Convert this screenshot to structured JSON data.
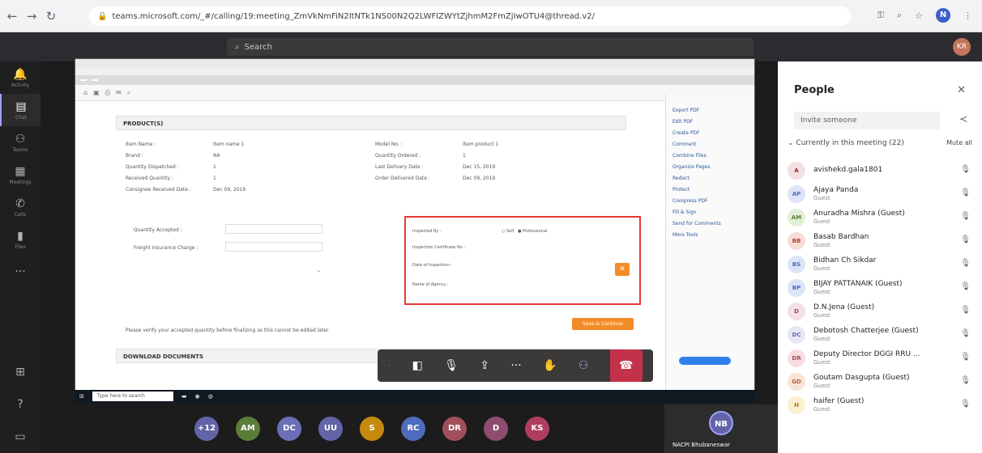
{
  "browser": {
    "url": "teams.microsoft.com/_#/calling/19:meeting_ZmVkNmFiN2ItNTk1NS00N2Q2LWFlZWYtZjhmM2FmZjIwOTU4@thread.v2/",
    "profile_initial": "N"
  },
  "teams": {
    "search_placeholder": "Search",
    "me_initials": "KR"
  },
  "rail": [
    {
      "icon": "bell-icon",
      "label": "Activity"
    },
    {
      "icon": "chat-icon",
      "label": "Chat"
    },
    {
      "icon": "teams-icon",
      "label": "Teams"
    },
    {
      "icon": "calendar-icon",
      "label": "Meetings"
    },
    {
      "icon": "phone-icon",
      "label": "Calls"
    },
    {
      "icon": "files-icon",
      "label": "Files"
    }
  ],
  "shared_screen": {
    "section_product": "PRODUCT(S)",
    "section_download": "DOWNLOAD DOCUMENTS",
    "verify_note": "Please verify your accepted quantity before finalizing as this cannot be edited later",
    "save_button": "Save & Continue",
    "left_fields": [
      "Item Name :",
      "Brand :",
      "Quantity Dispatched :",
      "Received Quantity :",
      "Consignee Received Date :"
    ],
    "left_values": [
      "Item name 1",
      "NA",
      "1",
      "1",
      "Dec 09, 2019"
    ],
    "right_fields": [
      "Model No. :",
      "Quantity Ordered :",
      "Last Delivery Date :",
      "Order Delivered Date :"
    ],
    "right_values": [
      "Item product 1",
      "1",
      "Dec 15, 2019",
      "Dec 09, 2019"
    ],
    "accept_fields": [
      "Quantity Accepted :",
      "Freight Insurance Charge :"
    ],
    "inspection_labels": [
      "Inspected By :",
      "Inspection Certificate No :",
      "Date of Inspection :",
      "Name of Agency :"
    ],
    "inspected_options": [
      "Self",
      "Professional"
    ],
    "taskbar_search": "Type here to search",
    "pdf_items": [
      "Export PDF",
      "Edit PDF",
      "Create PDF",
      "Comment",
      "Combine Files",
      "Organize Pages",
      "Redact",
      "Protect",
      "Compress PDF",
      "Fill & Sign",
      "Send for Comments",
      "More Tools"
    ]
  },
  "avatars": [
    {
      "initials": "+12",
      "color": "#6264a7"
    },
    {
      "initials": "AM",
      "color": "#5b7d3a"
    },
    {
      "initials": "DC",
      "color": "#6b6fb5"
    },
    {
      "initials": "UU",
      "color": "#6264a7"
    },
    {
      "initials": "S",
      "color": "#c58a0d"
    },
    {
      "initials": "RC",
      "color": "#4f6bbd"
    },
    {
      "initials": "DR",
      "color": "#a0505a"
    },
    {
      "initials": "D",
      "color": "#8e4c6e"
    },
    {
      "initials": "KS",
      "color": "#b03d5f"
    }
  ],
  "self": {
    "initials": "NB",
    "name": "NACPI Bhubaneswar"
  },
  "people": {
    "title": "People",
    "invite_placeholder": "Invite someone",
    "section": "Currently in this meeting (22)",
    "mute_all": "Mute all",
    "list": [
      {
        "initials": "A",
        "name": "avishekd.gala1801",
        "sub": "",
        "bg": "#f3e0e0",
        "fg": "#a4262c"
      },
      {
        "initials": "AP",
        "name": "Ajaya Panda",
        "sub": "Guest",
        "bg": "#dde4f8",
        "fg": "#4f6bbd"
      },
      {
        "initials": "AM",
        "name": "Anuradha Mishra (Guest)",
        "sub": "Guest",
        "bg": "#e3efd8",
        "fg": "#5b7d3a"
      },
      {
        "initials": "BB",
        "name": "Basab Bardhan",
        "sub": "Guest",
        "bg": "#f8dcd8",
        "fg": "#b04632"
      },
      {
        "initials": "BS",
        "name": "Bidhan Ch Sikdar",
        "sub": "Guest",
        "bg": "#dde4f8",
        "fg": "#4f6bbd"
      },
      {
        "initials": "BP",
        "name": "BIJAY PATTANAIK (Guest)",
        "sub": "Guest",
        "bg": "#dde4f8",
        "fg": "#4f6bbd"
      },
      {
        "initials": "D",
        "name": "D.N.Jena (Guest)",
        "sub": "Guest",
        "bg": "#f3dfe6",
        "fg": "#8e4c6e"
      },
      {
        "initials": "DC",
        "name": "Debotosh Chatterjee (Guest)",
        "sub": "Guest",
        "bg": "#e6e6f5",
        "fg": "#6b6fb5"
      },
      {
        "initials": "DR",
        "name": "Deputy Director DGGI RRU ...",
        "sub": "Guest",
        "bg": "#f5dde0",
        "fg": "#a0505a"
      },
      {
        "initials": "GD",
        "name": "Goutam Dasgupta (Guest)",
        "sub": "Guest",
        "bg": "#f8e4d8",
        "fg": "#b0643a"
      },
      {
        "initials": "H",
        "name": "haifer (Guest)",
        "sub": "Guest",
        "bg": "#fbf0d0",
        "fg": "#a67c0a"
      }
    ]
  }
}
